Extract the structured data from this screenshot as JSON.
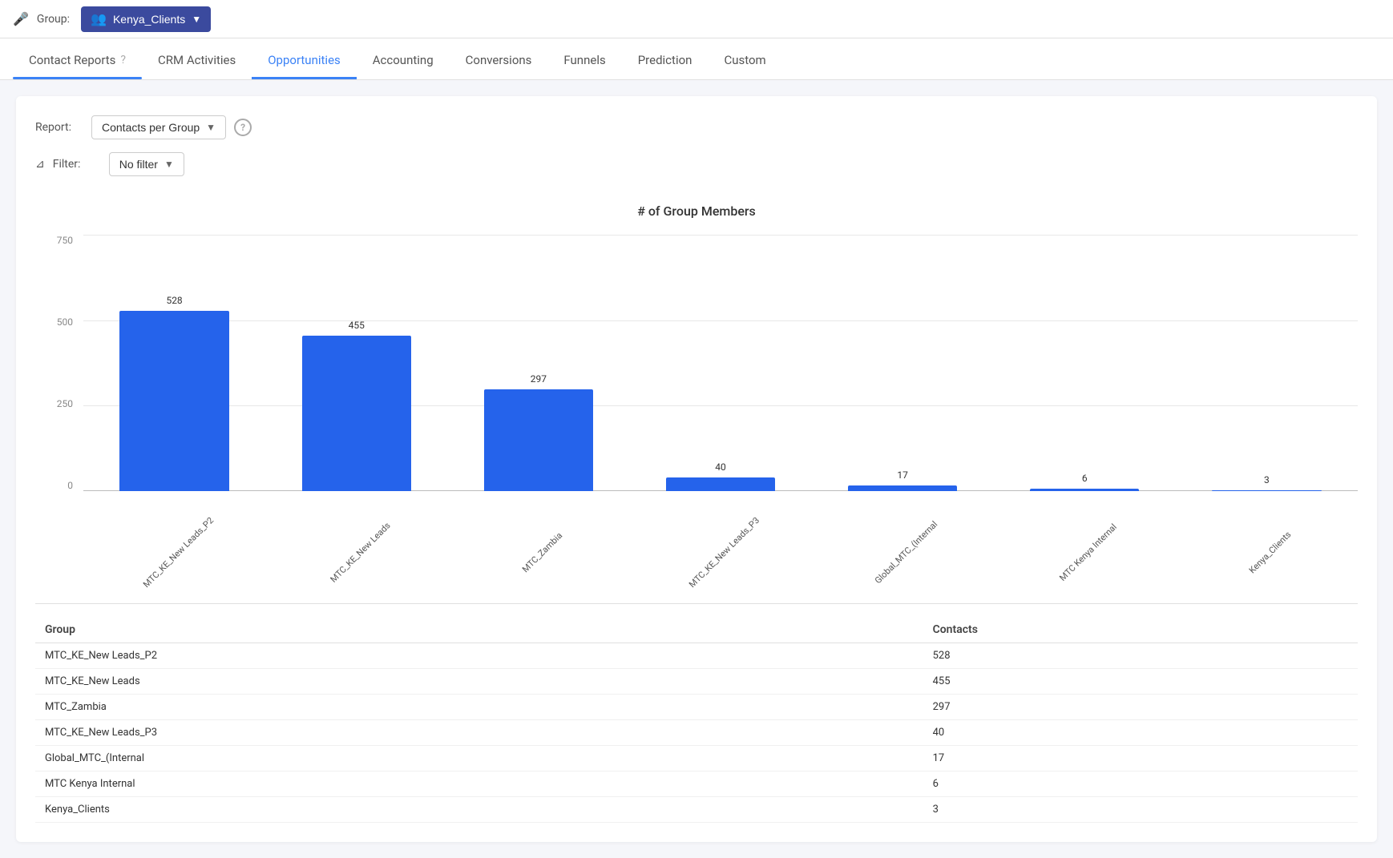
{
  "topbar": {
    "group_label": "Group:",
    "group_name": "Kenya_Clients"
  },
  "tabs": [
    {
      "id": "contact-reports",
      "label": "Contact Reports",
      "active": false,
      "has_help": true
    },
    {
      "id": "crm-activities",
      "label": "CRM Activities",
      "active": false,
      "has_help": false
    },
    {
      "id": "opportunities",
      "label": "Opportunities",
      "active": true,
      "has_help": false
    },
    {
      "id": "accounting",
      "label": "Accounting",
      "active": false,
      "has_help": false
    },
    {
      "id": "conversions",
      "label": "Conversions",
      "active": false,
      "has_help": false
    },
    {
      "id": "funnels",
      "label": "Funnels",
      "active": false,
      "has_help": false
    },
    {
      "id": "prediction",
      "label": "Prediction",
      "active": false,
      "has_help": false
    },
    {
      "id": "custom",
      "label": "Custom",
      "active": false,
      "has_help": false
    }
  ],
  "report": {
    "report_label": "Report:",
    "report_name": "Contacts per Group",
    "filter_label": "Filter:",
    "filter_value": "No filter"
  },
  "chart": {
    "title": "# of Group Members",
    "y_labels": [
      "750",
      "500",
      "250",
      "0"
    ],
    "max_value": 750,
    "bars": [
      {
        "label": "MTC_KE_New Leads_P2",
        "value": 528
      },
      {
        "label": "MTC_KE_New Leads",
        "value": 455
      },
      {
        "label": "MTC_Zambia",
        "value": 297
      },
      {
        "label": "MTC_KE_New Leads_P3",
        "value": 40
      },
      {
        "label": "Global_MTC_(Internal",
        "value": 17
      },
      {
        "label": "MTC Kenya Internal",
        "value": 6
      },
      {
        "label": "Kenya_Clients",
        "value": 3
      }
    ]
  },
  "table": {
    "headers": [
      "Group",
      "Contacts"
    ]
  }
}
